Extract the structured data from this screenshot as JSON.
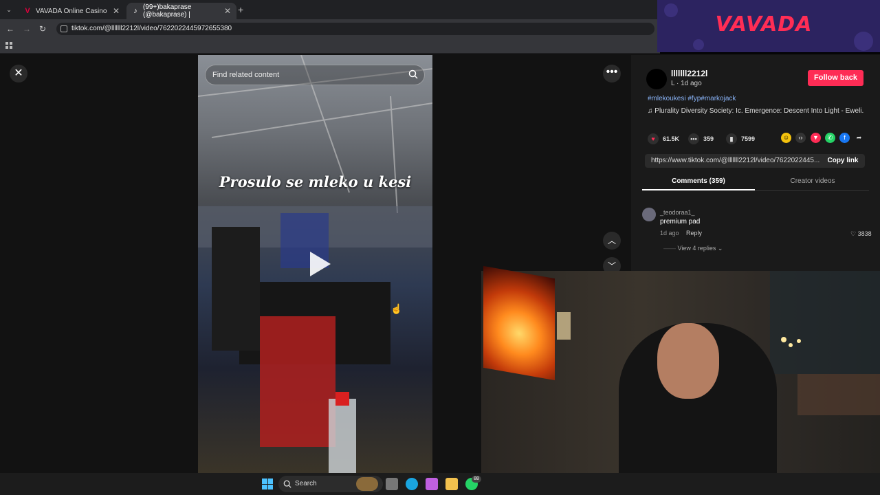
{
  "browser": {
    "tabs": [
      {
        "label": "VAVADA Online Casino",
        "favicon": "V"
      },
      {
        "label": "(99+)bakaprase (@bakaprase) |",
        "favicon": "♪"
      }
    ],
    "new_tab": "+",
    "url": "tiktok.com/@lllllll2212l/video/7622022445972655380"
  },
  "banner": {
    "logo": "VAVADA"
  },
  "video": {
    "search_placeholder": "Find related content",
    "caption": "Prosulo se mleko u kesi",
    "close": "✕",
    "more": "•••",
    "up": "︿",
    "down": "﹀"
  },
  "post": {
    "username": "lllllll2212l",
    "meta": "L · 1d ago",
    "follow_label": "Follow back",
    "tags": "#mlekoukesi #fyp#markojack",
    "music": "Plurality Diversity Society: Ic. Emergence: Descent Into Light - Eweli...",
    "likes": "61.5K",
    "comments": "359",
    "saves": "7599",
    "link": "https://www.tiktok.com/@lllllll2212l/video/7622022445...",
    "copy_label": "Copy link",
    "tab_comments": "Comments (359)",
    "tab_creator": "Creator videos"
  },
  "comment": {
    "user": "_teodoraa1_",
    "text": "premium pad",
    "time": "1d ago",
    "reply": "Reply",
    "likes": "3838",
    "view_replies": "View 4 replies"
  },
  "taskbar": {
    "search_label": "Search",
    "badge": "88"
  },
  "colors": {
    "tiktok_red": "#fe2c55",
    "vavada_red": "#ff2d55",
    "link_blue": "#8ab4f8"
  }
}
